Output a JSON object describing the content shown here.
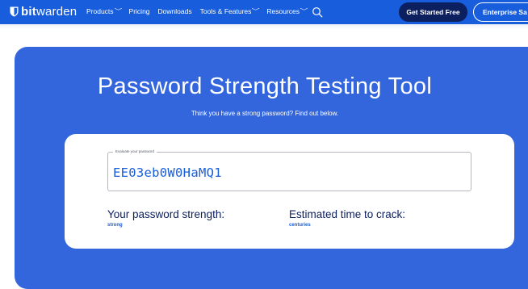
{
  "nav": {
    "logo": {
      "brand_bold": "bit",
      "brand_light": "warden",
      "icon": "shield-icon"
    },
    "items": [
      {
        "label": "Products",
        "has_dropdown": true
      },
      {
        "label": "Pricing",
        "has_dropdown": false
      },
      {
        "label": "Downloads",
        "has_dropdown": false
      },
      {
        "label": "Tools & Features",
        "has_dropdown": true
      },
      {
        "label": "Resources",
        "has_dropdown": true
      }
    ],
    "search_icon": "search-icon",
    "chevron_glyph": "﹀",
    "cta_primary": "Get Started Free",
    "cta_secondary": "Enterprise Sa"
  },
  "hero": {
    "title": "Password Strength Testing Tool",
    "subtitle": "Think you have a strong password? Find out below."
  },
  "tester": {
    "field_label": "Evaluate your password",
    "password_value": "EE03eb0W0HaMQ1",
    "strength_label": "Your password strength:",
    "strength_value": "strong",
    "crack_label": "Estimated time to crack:",
    "crack_value": "centuries"
  },
  "colors": {
    "nav_bg": "#175ddc",
    "hero_bg": "#3366dd",
    "primary_button_bg": "#0c1f5e",
    "accent_text": "#175ddc",
    "heading_text": "#0c1f5e"
  }
}
